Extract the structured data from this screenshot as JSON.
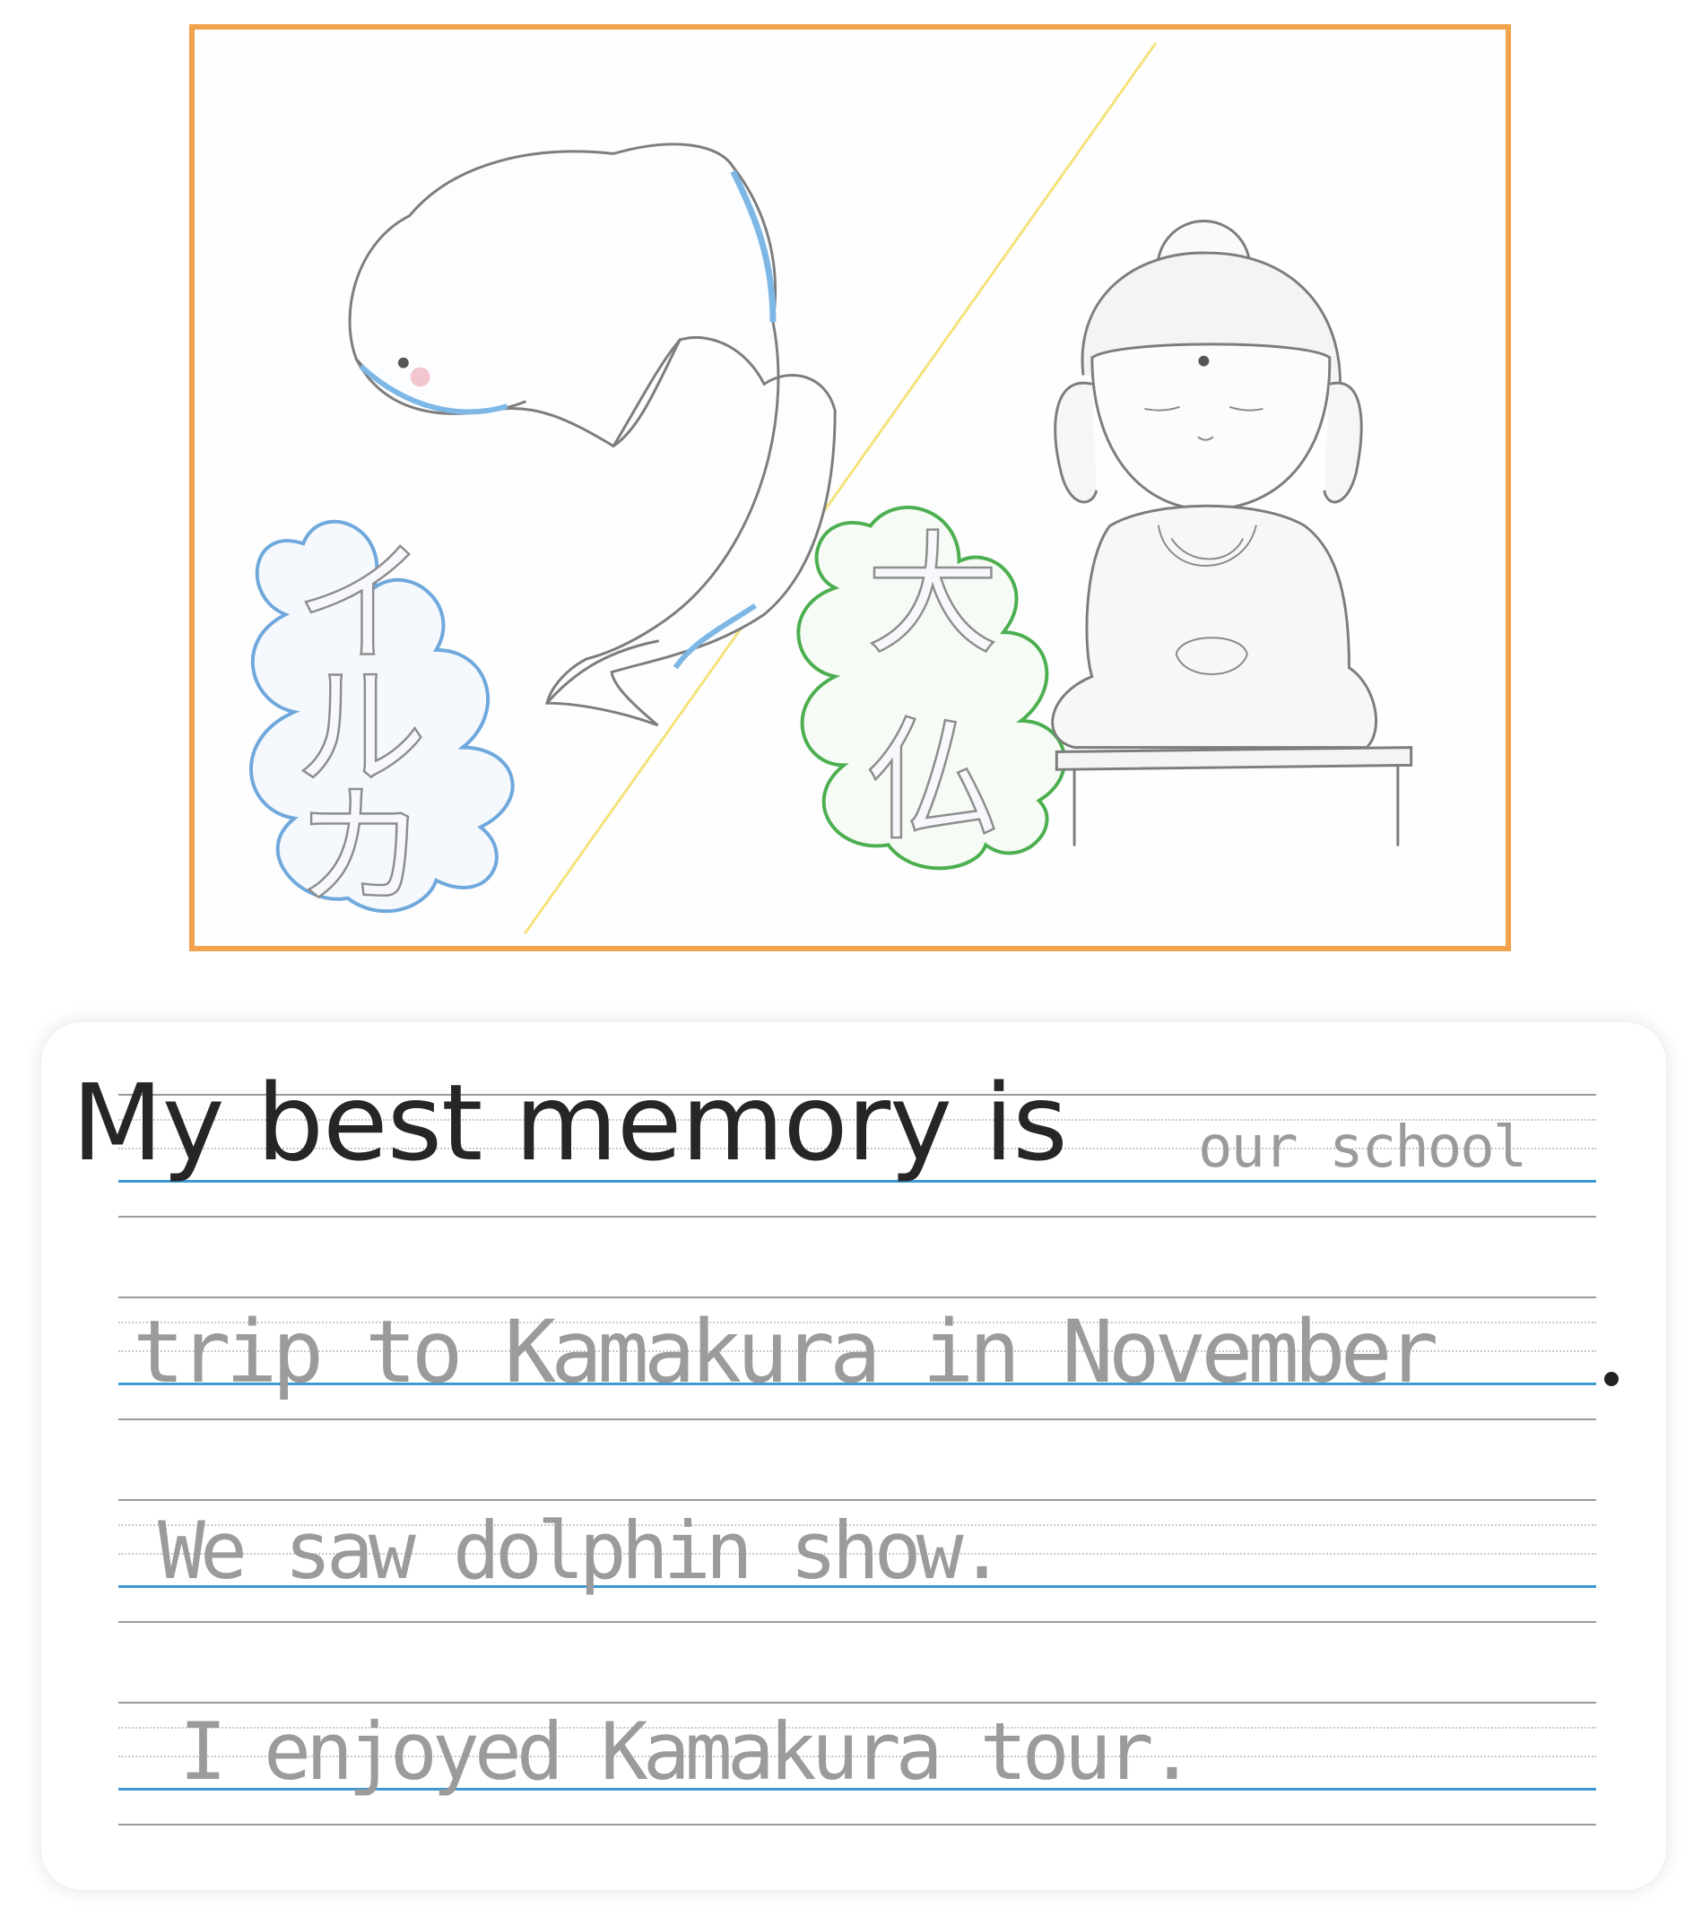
{
  "drawing": {
    "label_left": "イルカ",
    "label_right": "大仏",
    "colors": {
      "frame": "#f0a24c",
      "dolphin_accent": "#7db7e6",
      "cloud_left": "#6fa8dc",
      "cloud_right": "#4caf50",
      "divider": "#f4e27a"
    }
  },
  "card": {
    "prompt": "My best memory is",
    "lines": [
      "our school",
      "trip to Kamakura in November",
      "We saw dolphin show.",
      "I enjoyed Kamakura tour."
    ],
    "period": "."
  }
}
